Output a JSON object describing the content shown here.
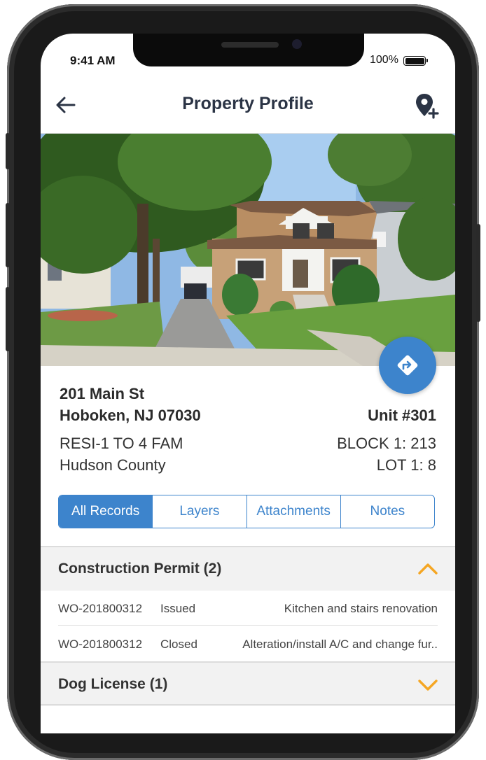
{
  "status_bar": {
    "time": "9:41 AM",
    "battery": "100%"
  },
  "header": {
    "title": "Property Profile",
    "back_icon": "arrow-left-icon",
    "action_icon": "add-location-pin-icon"
  },
  "photo": {
    "description_icon": "house-street-photo"
  },
  "property": {
    "street": "201 Main St",
    "city_line": "Hoboken, NJ 07030",
    "unit": "Unit #301",
    "class": "RESI-1 TO 4 FAM",
    "county": "Hudson County",
    "block": "BLOCK 1: 213",
    "lot": "LOT 1: 8"
  },
  "tabs": [
    {
      "label": "All Records",
      "active": true
    },
    {
      "label": "Layers",
      "active": false
    },
    {
      "label": "Attachments",
      "active": false
    },
    {
      "label": "Notes",
      "active": false
    }
  ],
  "sections": [
    {
      "title": "Construction Permit (2)",
      "expanded": true,
      "records": [
        {
          "id": "WO-201800312",
          "status": "Issued",
          "description": "Kitchen and stairs renovation"
        },
        {
          "id": "WO-201800312",
          "status": "Closed",
          "description": "Alteration/install A/C and change fur.."
        }
      ]
    },
    {
      "title": "Dog License (1)",
      "expanded": false,
      "records": []
    }
  ],
  "colors": {
    "accent": "#3d84cc",
    "chevron": "#f5a623",
    "title_text": "#2b3445"
  }
}
